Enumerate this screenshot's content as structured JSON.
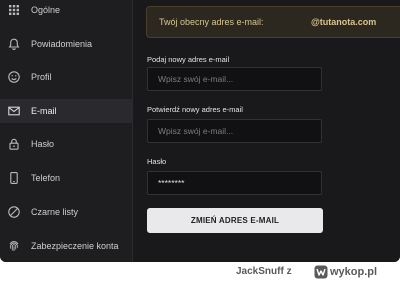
{
  "sidebar": {
    "items": [
      {
        "label": "Ogólne",
        "icon": "grid-icon"
      },
      {
        "label": "Powiadomienia",
        "icon": "bell-icon"
      },
      {
        "label": "Profil",
        "icon": "smiley-icon"
      },
      {
        "label": "E-mail",
        "icon": "envelope-icon"
      },
      {
        "label": "Hasło",
        "icon": "lock-icon"
      },
      {
        "label": "Telefon",
        "icon": "phone-icon"
      },
      {
        "label": "Czarne listy",
        "icon": "blocked-icon"
      },
      {
        "label": "Zabezpieczenie konta",
        "icon": "fingerprint-icon"
      }
    ],
    "active": "E-mail"
  },
  "banner": {
    "label": "Twój obecny adres e-mail:",
    "value": "@tutanota.com"
  },
  "form": {
    "new_email": {
      "label": "Podaj nowy adres e-mail",
      "placeholder": "Wpisz swój e-mail...",
      "value": ""
    },
    "confirm_email": {
      "label": "Potwierdź nowy adres e-mail",
      "placeholder": "Wpisz swój e-mail...",
      "value": ""
    },
    "password": {
      "label": "Hasło",
      "value": "********"
    },
    "submit_label": "ZMIEŃ ADRES E-MAIL"
  },
  "footer": {
    "user": "JackSnuff",
    "separator": "z",
    "brand": "wykop.pl"
  },
  "colors": {
    "banner_bg": "#2c2820",
    "banner_text": "#d8c592",
    "button_bg": "#e9e9ec"
  }
}
